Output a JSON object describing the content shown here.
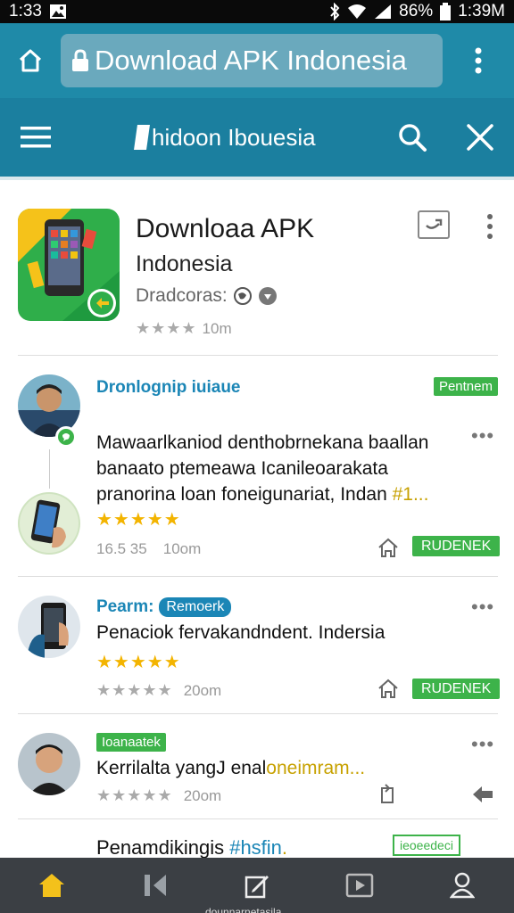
{
  "status_bar": {
    "time": "1:33",
    "battery_percent": "86%",
    "clock_right": "1:39M"
  },
  "browser": {
    "url_text": "Download APK Indonesia"
  },
  "header": {
    "title": "hidoon Ibouesia"
  },
  "app": {
    "name": "Downloaa APK",
    "subtitle": "Indonesia",
    "developer": "Dradcoras:",
    "stars": "★★★★",
    "meta": "10m"
  },
  "feed": [
    {
      "title": "Dronlognip iuiaue",
      "badge": "Pentnem",
      "body_lines": [
        "Mawaarlkaniod denthobrnekana baallan",
        "banaato ptemeawa Icanileoarakata",
        "pranorina loan foneigunariat, Indan"
      ],
      "body_tail": "#1...",
      "stars": "★★★★★",
      "meta_left": "16.5 35",
      "meta_size": "10om",
      "action": "RUDENEK"
    },
    {
      "title": "Pearm:",
      "tag": "Remoerk",
      "body": "Penaciok fervakandndent. Indersia",
      "stars": "★★★★★",
      "stars_gray": "★★★★★",
      "meta_size": "20om",
      "action": "RUDENEK"
    },
    {
      "badge": "Ioanaatek",
      "body_start": "Kerrilalta yangJ enal",
      "body_highlight": "oneimram...",
      "stars_gray": "★★★★★",
      "meta_size": "20om"
    },
    {
      "title_start": "Penamdikingis",
      "title_highlight": "#hsfin",
      "title_end": ".",
      "badge": "ieoeedeci"
    }
  ],
  "bottom_nav": {
    "caption": "dounnarnetasila"
  },
  "colors": {
    "browser_bar": "#1f8aa8",
    "app_header": "#1b7f9f",
    "accent_green": "#3db34a",
    "star_yellow": "#f3b400",
    "nav_bg": "#3b3f44"
  }
}
